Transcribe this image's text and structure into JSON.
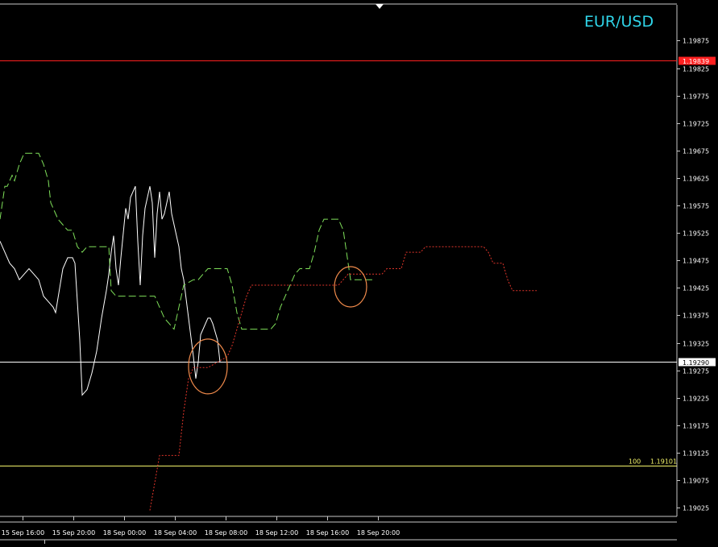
{
  "symbol": "EUR/USD",
  "chart_data": {
    "type": "line",
    "title": "EUR/USD",
    "x_ticks": [
      "15 Sep 16:00",
      "15 Sep 20:00",
      "18 Sep 00:00",
      "18 Sep 04:00",
      "18 Sep 08:00",
      "18 Sep 12:00",
      "18 Sep 16:00",
      "18 Sep 20:00"
    ],
    "y_ticks": [
      "1.19875",
      "1.19825",
      "1.19775",
      "1.19725",
      "1.19675",
      "1.19625",
      "1.19575",
      "1.19525",
      "1.19475",
      "1.19425",
      "1.19375",
      "1.19325",
      "1.19275",
      "1.19225",
      "1.19175",
      "1.19125",
      "1.19075",
      "1.19025"
    ],
    "ylim": [
      1.1902,
      1.1989
    ],
    "horizontal_lines": [
      {
        "label": "1.19839",
        "value": 1.19839,
        "color": "#ff2020",
        "label_bg": "#ff2020",
        "label_fg": "#ffffff"
      },
      {
        "label": "1.19290",
        "value": 1.1929,
        "color": "#ffffff",
        "label_bg": "#ffffff",
        "label_fg": "#000000"
      },
      {
        "label": "1.19101",
        "value": 1.19101,
        "color": "#f2f26a",
        "level_text": "100"
      }
    ],
    "series": [
      {
        "color": "#ffffff",
        "style": "solid",
        "points": [
          [
            0,
            1.1951
          ],
          [
            2,
            1.1949
          ],
          [
            4,
            1.1947
          ],
          [
            6,
            1.1946
          ],
          [
            8,
            1.1944
          ],
          [
            10,
            1.1945
          ],
          [
            12,
            1.1946
          ],
          [
            14,
            1.1945
          ],
          [
            16,
            1.1944
          ],
          [
            18,
            1.1941
          ],
          [
            20,
            1.194
          ],
          [
            22,
            1.1939
          ],
          [
            23,
            1.1938
          ],
          [
            26,
            1.1946
          ],
          [
            28,
            1.1948
          ],
          [
            30,
            1.1948
          ],
          [
            31,
            1.1947
          ],
          [
            33,
            1.1933
          ],
          [
            34,
            1.1923
          ],
          [
            36,
            1.1924
          ],
          [
            38,
            1.1927
          ],
          [
            40,
            1.1931
          ],
          [
            42,
            1.1937
          ],
          [
            44,
            1.1942
          ],
          [
            45,
            1.1945
          ],
          [
            46,
            1.1949
          ],
          [
            47,
            1.1952
          ],
          [
            48,
            1.1946
          ],
          [
            49,
            1.1943
          ],
          [
            50,
            1.1948
          ],
          [
            52,
            1.1957
          ],
          [
            53,
            1.1955
          ],
          [
            54,
            1.1959
          ],
          [
            56,
            1.1961
          ],
          [
            57,
            1.1951
          ],
          [
            58,
            1.1943
          ],
          [
            59,
            1.1952
          ],
          [
            60,
            1.1957
          ],
          [
            62,
            1.1961
          ],
          [
            63,
            1.1958
          ],
          [
            64,
            1.1948
          ],
          [
            65,
            1.1956
          ],
          [
            66,
            1.196
          ],
          [
            67,
            1.1955
          ],
          [
            68,
            1.1956
          ],
          [
            70,
            1.196
          ],
          [
            71,
            1.1956
          ],
          [
            72,
            1.1954
          ],
          [
            73,
            1.1952
          ],
          [
            74,
            1.195
          ],
          [
            75,
            1.1946
          ],
          [
            76,
            1.1944
          ],
          [
            78,
            1.1937
          ],
          [
            80,
            1.193
          ],
          [
            81,
            1.1926
          ],
          [
            82,
            1.1929
          ],
          [
            83,
            1.1934
          ],
          [
            85,
            1.1936
          ],
          [
            86,
            1.1937
          ],
          [
            87,
            1.1937
          ],
          [
            88,
            1.1936
          ],
          [
            90,
            1.1933
          ],
          [
            91,
            1.1929
          ]
        ]
      },
      {
        "color": "#7fe05a",
        "style": "dashed",
        "points": [
          [
            0,
            1.1955
          ],
          [
            1,
            1.1958
          ],
          [
            2,
            1.1961
          ],
          [
            3,
            1.1961
          ],
          [
            4,
            1.1962
          ],
          [
            5,
            1.1963
          ],
          [
            6,
            1.1962
          ],
          [
            8,
            1.1965
          ],
          [
            10,
            1.1967
          ],
          [
            12,
            1.1967
          ],
          [
            14,
            1.1967
          ],
          [
            16,
            1.1967
          ],
          [
            18,
            1.1965
          ],
          [
            20,
            1.1962
          ],
          [
            21,
            1.1958
          ],
          [
            22,
            1.1957
          ],
          [
            24,
            1.1955
          ],
          [
            26,
            1.1954
          ],
          [
            28,
            1.1953
          ],
          [
            30,
            1.1953
          ],
          [
            32,
            1.195
          ],
          [
            34,
            1.1949
          ],
          [
            36,
            1.195
          ],
          [
            38,
            1.195
          ],
          [
            40,
            1.195
          ],
          [
            42,
            1.195
          ],
          [
            44,
            1.195
          ],
          [
            45,
            1.195
          ],
          [
            46,
            1.1942
          ],
          [
            48,
            1.1941
          ],
          [
            50,
            1.1941
          ],
          [
            52,
            1.1941
          ],
          [
            54,
            1.1941
          ],
          [
            56,
            1.1941
          ],
          [
            60,
            1.1941
          ],
          [
            64,
            1.1941
          ],
          [
            66,
            1.1939
          ],
          [
            68,
            1.1937
          ],
          [
            70,
            1.1936
          ],
          [
            72,
            1.1935
          ],
          [
            74,
            1.1939
          ],
          [
            76,
            1.1943
          ],
          [
            80,
            1.1944
          ],
          [
            82,
            1.1944
          ],
          [
            84,
            1.1945
          ],
          [
            86,
            1.1946
          ],
          [
            88,
            1.1946
          ],
          [
            90,
            1.1946
          ],
          [
            92,
            1.1946
          ],
          [
            94,
            1.1946
          ],
          [
            96,
            1.1943
          ],
          [
            98,
            1.1938
          ],
          [
            100,
            1.1935
          ],
          [
            104,
            1.1935
          ],
          [
            108,
            1.1935
          ],
          [
            112,
            1.1935
          ],
          [
            114,
            1.1936
          ],
          [
            116,
            1.1939
          ],
          [
            118,
            1.1941
          ],
          [
            120,
            1.1943
          ],
          [
            122,
            1.1945
          ],
          [
            124,
            1.1946
          ],
          [
            126,
            1.1946
          ],
          [
            128,
            1.1946
          ],
          [
            130,
            1.1949
          ],
          [
            132,
            1.1953
          ],
          [
            134,
            1.1955
          ],
          [
            136,
            1.1955
          ],
          [
            138,
            1.1955
          ],
          [
            140,
            1.1955
          ],
          [
            142,
            1.1953
          ],
          [
            143,
            1.195
          ],
          [
            144,
            1.1947
          ],
          [
            145,
            1.1944
          ],
          [
            147,
            1.1944
          ],
          [
            150,
            1.1944
          ],
          [
            154,
            1.1944
          ]
        ]
      },
      {
        "color": "#e0352a",
        "style": "dotted",
        "points": [
          [
            62,
            1.1902
          ],
          [
            64,
            1.1907
          ],
          [
            66,
            1.1912
          ],
          [
            70,
            1.1912
          ],
          [
            74,
            1.1912
          ],
          [
            76,
            1.192
          ],
          [
            78,
            1.1926
          ],
          [
            80,
            1.1928
          ],
          [
            82,
            1.1928
          ],
          [
            86,
            1.1928
          ],
          [
            90,
            1.1929
          ],
          [
            94,
            1.193
          ],
          [
            96,
            1.1932
          ],
          [
            98,
            1.1935
          ],
          [
            100,
            1.1938
          ],
          [
            102,
            1.1941
          ],
          [
            104,
            1.1943
          ],
          [
            108,
            1.1943
          ],
          [
            112,
            1.1943
          ],
          [
            116,
            1.1943
          ],
          [
            120,
            1.1943
          ],
          [
            124,
            1.1943
          ],
          [
            128,
            1.1943
          ],
          [
            132,
            1.1943
          ],
          [
            136,
            1.1943
          ],
          [
            138,
            1.1943
          ],
          [
            140,
            1.1943
          ],
          [
            142,
            1.1944
          ],
          [
            144,
            1.1945
          ],
          [
            148,
            1.1945
          ],
          [
            152,
            1.1945
          ],
          [
            156,
            1.1945
          ],
          [
            158,
            1.1945
          ],
          [
            160,
            1.1946
          ],
          [
            164,
            1.1946
          ],
          [
            166,
            1.1946
          ],
          [
            168,
            1.1949
          ],
          [
            170,
            1.1949
          ],
          [
            172,
            1.1949
          ],
          [
            174,
            1.1949
          ],
          [
            176,
            1.195
          ],
          [
            180,
            1.195
          ],
          [
            184,
            1.195
          ],
          [
            190,
            1.195
          ],
          [
            196,
            1.195
          ],
          [
            200,
            1.195
          ],
          [
            202,
            1.1949
          ],
          [
            204,
            1.1947
          ],
          [
            206,
            1.1947
          ],
          [
            208,
            1.1947
          ],
          [
            210,
            1.1944
          ],
          [
            212,
            1.1942
          ],
          [
            214,
            1.1942
          ],
          [
            216,
            1.1942
          ],
          [
            218,
            1.1942
          ],
          [
            220,
            1.1942
          ],
          [
            222,
            1.1942
          ]
        ]
      }
    ],
    "annotations": [
      {
        "type": "ellipse",
        "color": "#f08a4b",
        "cx": 85,
        "cy": 1.19285
      },
      {
        "type": "ellipse",
        "color": "#f08a4b",
        "cx": 144,
        "cy": 1.1943
      }
    ],
    "x_axis": {
      "bars_per_tick": 21,
      "first_tick_bar": 0
    },
    "grid": false
  }
}
